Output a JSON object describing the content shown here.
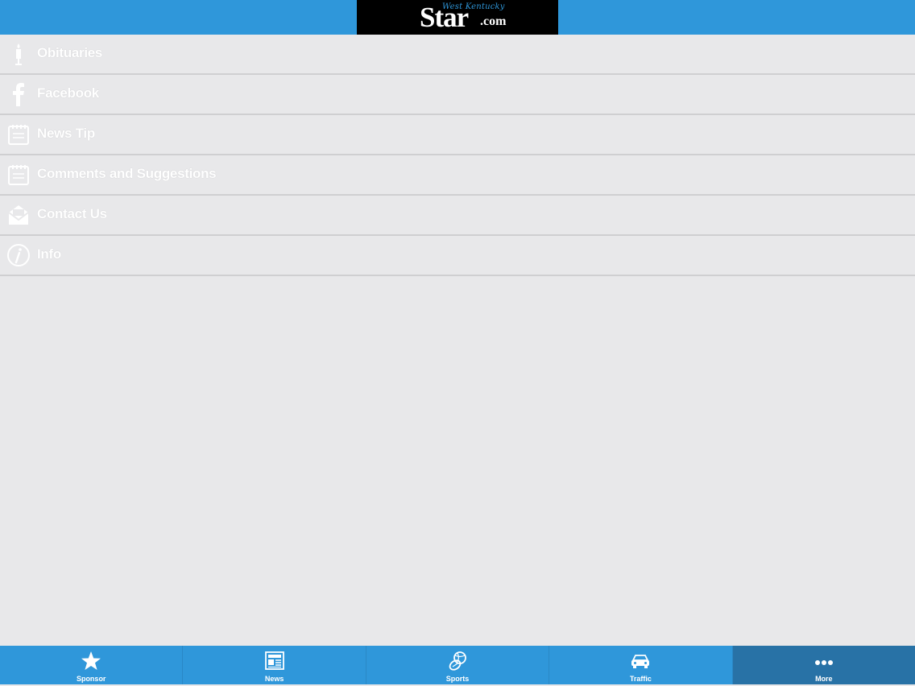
{
  "header": {
    "logo": {
      "tagline": "West Kentucky",
      "word": "Star",
      "suffix": ".com"
    },
    "colors": {
      "bar": "#2f97da",
      "logo_bg": "#000000"
    }
  },
  "menu": {
    "items": [
      {
        "label": "Obituaries",
        "icon": "candle-icon"
      },
      {
        "label": "Facebook",
        "icon": "facebook-icon"
      },
      {
        "label": "News Tip",
        "icon": "notepad-icon"
      },
      {
        "label": "Comments and Suggestions",
        "icon": "notepad-icon"
      },
      {
        "label": "Contact Us",
        "icon": "envelope-icon"
      },
      {
        "label": "Info",
        "icon": "info-icon"
      }
    ]
  },
  "tabbar": {
    "tabs": [
      {
        "label": "Sponsor",
        "icon": "star-icon",
        "active": false
      },
      {
        "label": "News",
        "icon": "newspaper-icon",
        "active": false
      },
      {
        "label": "Sports",
        "icon": "sports-balls-icon",
        "active": false
      },
      {
        "label": "Traffic",
        "icon": "car-icon",
        "active": false
      },
      {
        "label": "More",
        "icon": "more-dots-icon",
        "active": true
      }
    ],
    "colors": {
      "bar": "#2f97da",
      "active": "#2872a6"
    }
  }
}
